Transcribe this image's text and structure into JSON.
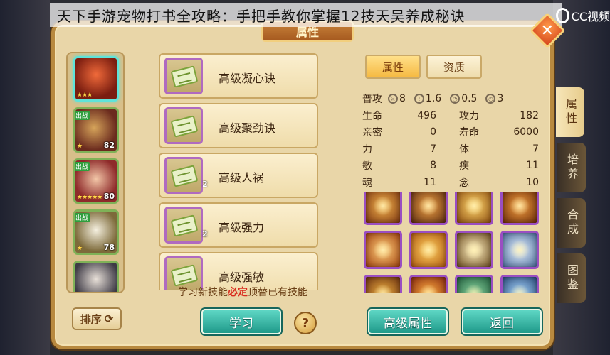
{
  "article_title": "天下手游宠物打书全攻略：手把手教你掌握12技天吴养成秘诀",
  "watermark": "CC视频",
  "panel": {
    "header": "属性",
    "close_icon": "close-icon"
  },
  "pets": [
    {
      "level": "",
      "stars": "★★★",
      "tag": "",
      "selected": true
    },
    {
      "level": "82",
      "stars": "★",
      "tag": "出战"
    },
    {
      "level": "80",
      "stars": "★★★★★",
      "tag": "出战"
    },
    {
      "level": "78",
      "stars": "★",
      "tag": "出战"
    },
    {
      "level": "",
      "stars": "",
      "tag": ""
    }
  ],
  "sort_button": "排序",
  "skills": [
    {
      "name": "高级凝心诀",
      "count": ""
    },
    {
      "name": "高级聚劲诀",
      "count": ""
    },
    {
      "name": "高级人祸",
      "count": "2"
    },
    {
      "name": "高级强力",
      "count": "2"
    },
    {
      "name": "高级强敏",
      "count": ""
    }
  ],
  "hint": {
    "prefix": "学习新技能",
    "strong": "必定",
    "suffix": "顶替已有技能"
  },
  "learn_button": "学习",
  "help_button": "?",
  "tabs": {
    "attr": "属性",
    "aptitude": "资质"
  },
  "special": {
    "label": "普攻",
    "items": [
      {
        "icon": "sword-icon",
        "value": "8"
      },
      {
        "icon": "exclaim-icon",
        "value": "1.6"
      },
      {
        "icon": "speed-icon",
        "value": "0.5"
      },
      {
        "icon": "clock-icon",
        "value": "3"
      }
    ]
  },
  "stats": [
    {
      "k": "生命",
      "v": "496",
      "k2": "攻力",
      "v2": "182"
    },
    {
      "k": "亲密",
      "v": "0",
      "k2": "寿命",
      "v2": "6000"
    },
    {
      "k": "力",
      "v": "7",
      "k2": "体",
      "v2": "7"
    },
    {
      "k": "敏",
      "v": "8",
      "k2": "疾",
      "v2": "11"
    },
    {
      "k": "魂",
      "v": "11",
      "k2": "念",
      "v2": "10"
    }
  ],
  "advanced_attr_button": "高级属性",
  "back_button": "返回",
  "side_tabs": [
    "属性",
    "培养",
    "合成",
    "图鉴"
  ],
  "colors": {
    "accent": "#f5b941",
    "teal": "#1f9a8a",
    "panel": "#e9d6a8"
  }
}
